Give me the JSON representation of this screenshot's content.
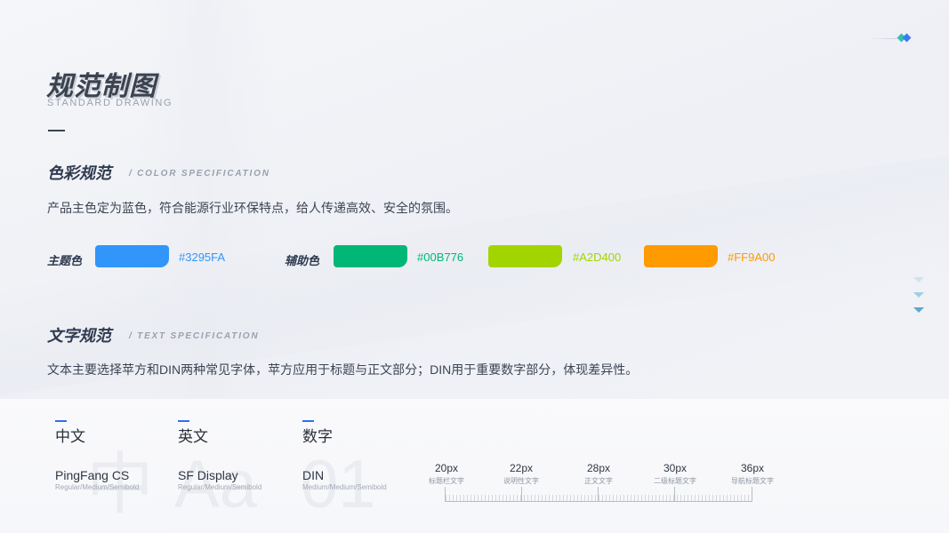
{
  "header": {
    "title": "规范制图",
    "subtitle": "STANDARD DRAWING"
  },
  "color_section": {
    "title": "色彩规范",
    "subtitle": "/ COLOR SPECIFICATION",
    "description": "产品主色定为蓝色，符合能源行业环保特点，给人传递高效、安全的氛围。",
    "primary_label": "主题色",
    "secondary_label": "辅助色",
    "primary": {
      "hex": "#3295FA",
      "color": "#3295FA"
    },
    "secondary": [
      {
        "hex": "#00B776",
        "color": "#00B776"
      },
      {
        "hex": "#A2D400",
        "color": "#A2D400"
      },
      {
        "hex": "#FF9A00",
        "color": "#FF9A00"
      }
    ]
  },
  "text_section": {
    "title": "文字规范",
    "subtitle": "/ TEXT SPECIFICATION",
    "description": "文本主要选择苹方和DIN两种常见字体，苹方应用于标题与正文部分；DIN用于重要数字部分，体现差异性。"
  },
  "fonts": [
    {
      "category": "中文",
      "name": "PingFang CS",
      "weights": "Regular/Medium/Semibold",
      "sample": "中"
    },
    {
      "category": "英文",
      "name": "SF Display",
      "weights": "Regular/Medium/Semibold",
      "sample": "Aa"
    },
    {
      "category": "数字",
      "name": "DIN",
      "weights": "Medium/Medium/Semibold",
      "sample": "01"
    }
  ],
  "type_scale": [
    {
      "size": "20px",
      "usage": "标题栏文字"
    },
    {
      "size": "22px",
      "usage": "说明性文字"
    },
    {
      "size": "28px",
      "usage": "正文文字"
    },
    {
      "size": "30px",
      "usage": "二级标题文字"
    },
    {
      "size": "36px",
      "usage": "导航标题文字"
    }
  ],
  "accent": "#2F6FF0"
}
